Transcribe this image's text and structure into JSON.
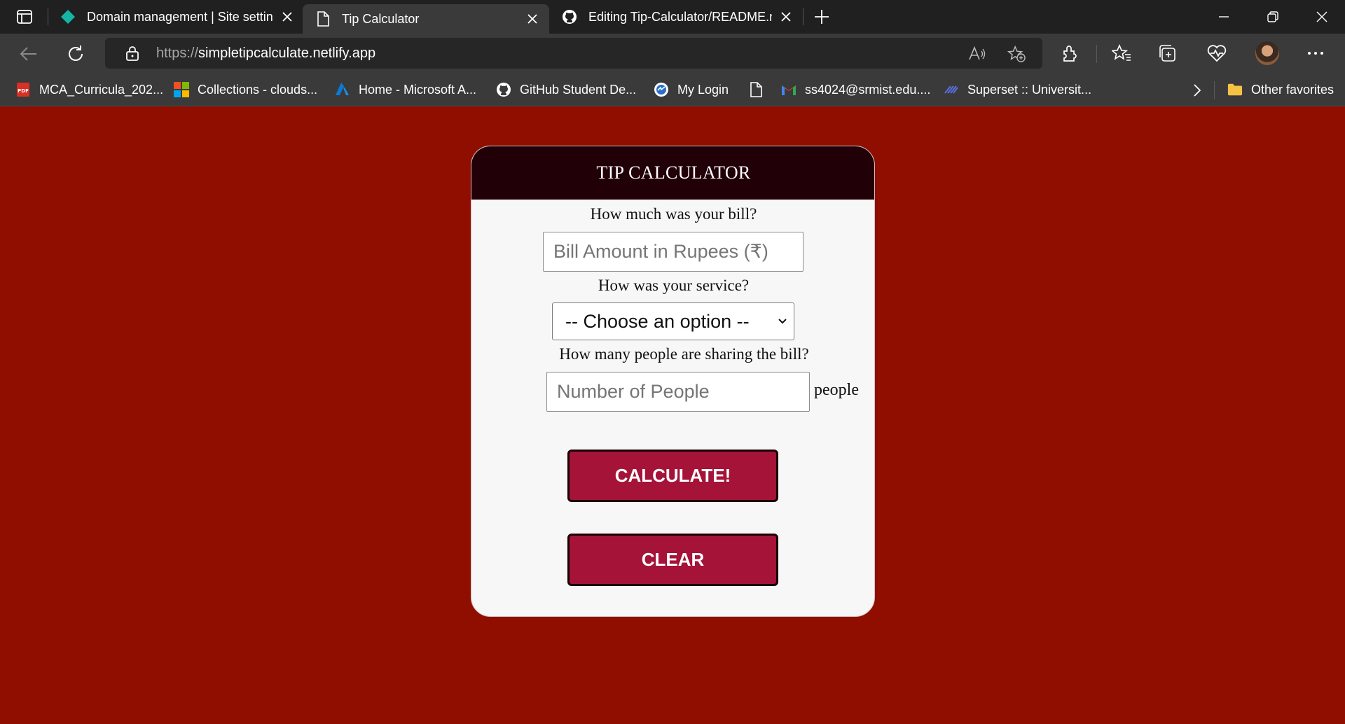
{
  "browser": {
    "tabs": [
      {
        "title": "Domain management | Site settin",
        "favicon": "netlify-diamond-icon",
        "active": false
      },
      {
        "title": "Tip Calculator",
        "favicon": "page-icon",
        "active": true
      },
      {
        "title": "Editing Tip-Calculator/README.m",
        "favicon": "github-icon",
        "active": false
      }
    ],
    "address": {
      "scheme": "https://",
      "host": "simpletipcalculate.netlify.app"
    },
    "bookmarks": [
      {
        "label": "MCA_Curricula_202...",
        "icon": "pdf-icon"
      },
      {
        "label": "Collections - clouds...",
        "icon": "microsoft-icon"
      },
      {
        "label": "Home - Microsoft A...",
        "icon": "azure-icon"
      },
      {
        "label": "GitHub Student De...",
        "icon": "github-icon"
      },
      {
        "label": "My Login",
        "icon": "login-icon"
      },
      {
        "label": "",
        "icon": "page-icon"
      },
      {
        "label": "ss4024@srmist.edu....",
        "icon": "gmail-icon"
      },
      {
        "label": "Superset :: Universit...",
        "icon": "superset-icon"
      }
    ],
    "other_favorites": "Other favorites",
    "colors": {
      "tabbar": "#202020",
      "toolbar": "#3a3a3a",
      "page_bg": "#8f0e00"
    }
  },
  "app": {
    "title": "TIP CALCULATOR",
    "bill_question": "How much was your bill?",
    "bill_placeholder": "Bill Amount in Rupees (₹)",
    "service_question": "How was your service?",
    "service_selected": "-- Choose an option --",
    "people_question": "How many people are sharing the bill?",
    "people_placeholder": "Number of People",
    "people_unit": "people",
    "calculate_label": "CALCULATE!",
    "clear_label": "CLEAR",
    "colors": {
      "header": "#210007",
      "button": "#a51338",
      "card": "#f7f7f7"
    }
  }
}
